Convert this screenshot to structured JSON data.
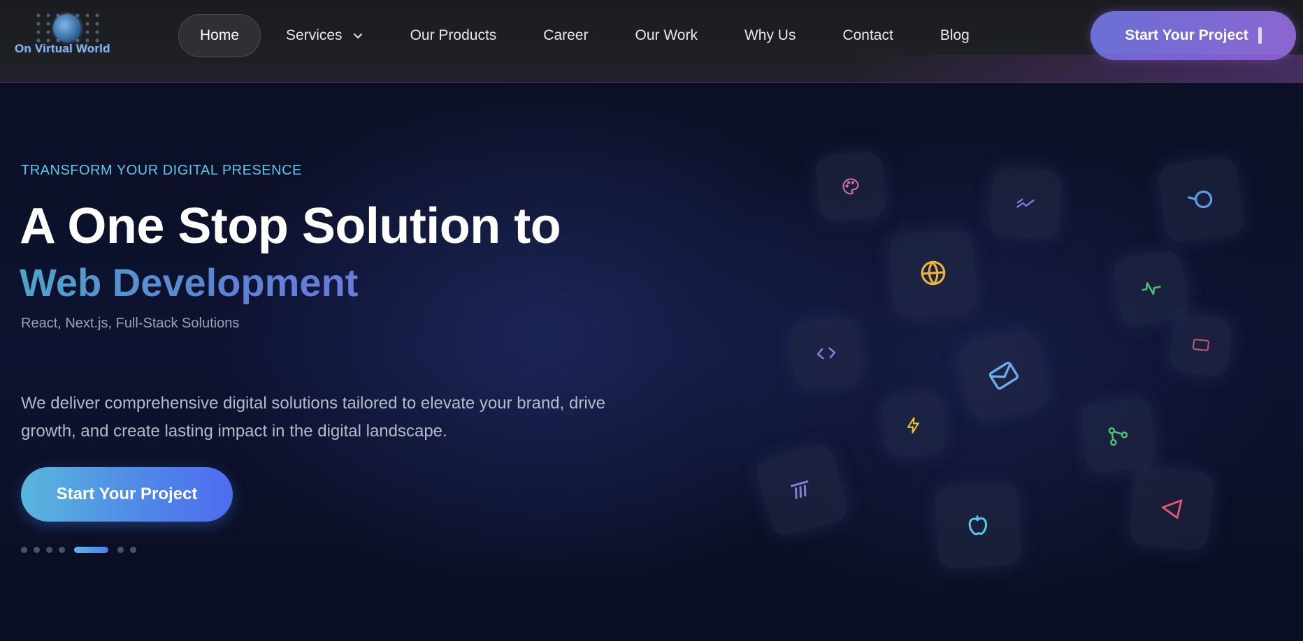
{
  "logo": {
    "text": "On Virtual World"
  },
  "nav": {
    "items": [
      {
        "label": "Home",
        "active": true
      },
      {
        "label": "Services",
        "has_dropdown": true
      },
      {
        "label": "Our Products"
      },
      {
        "label": "Career"
      },
      {
        "label": "Our Work"
      },
      {
        "label": "Why Us"
      },
      {
        "label": "Contact"
      },
      {
        "label": "Blog"
      }
    ],
    "cta_label": "Start Your Project"
  },
  "hero": {
    "eyebrow": "TRANSFORM YOUR DIGITAL PRESENCE",
    "headline": "A One Stop Solution to",
    "headline_accent": "Web Development",
    "tech_line": "React, Next.js, Full-Stack Solutions",
    "description": "We deliver comprehensive digital solutions tailored to elevate your brand, drive growth, and create lasting impact in the digital landscape.",
    "cta_label": "Start Your Project",
    "slides": {
      "count": 7,
      "active_index": 4
    }
  },
  "tiles": [
    {
      "icon": "palette-icon",
      "color": "#c86fa6"
    },
    {
      "icon": "trend-down-icon",
      "color": "#8b7be0"
    },
    {
      "icon": "search-circle-icon",
      "color": "#5c9be8"
    },
    {
      "icon": "globe-icon",
      "color": "#e8b73a"
    },
    {
      "icon": "activity-icon",
      "color": "#4cc06e"
    },
    {
      "icon": "code-icon",
      "color": "#9b7de8"
    },
    {
      "icon": "mail-icon",
      "color": "#6ab0f0"
    },
    {
      "icon": "monitor-icon",
      "color": "#c0566a"
    },
    {
      "icon": "lightning-icon",
      "color": "#e8c23a"
    },
    {
      "icon": "share-icon",
      "color": "#4cc06e"
    },
    {
      "icon": "layers-icon",
      "color": "#8b7be0"
    },
    {
      "icon": "apple-icon",
      "color": "#5ec6e6"
    },
    {
      "icon": "triangle-icon",
      "color": "#e05a6a"
    }
  ],
  "colors": {
    "accent": "#5ec6e6",
    "primary_gradient_start": "#58b7dc",
    "primary_gradient_end": "#4e6cf0",
    "nav_cta_start": "#6a6fd6",
    "nav_cta_end": "#8a66cf"
  }
}
